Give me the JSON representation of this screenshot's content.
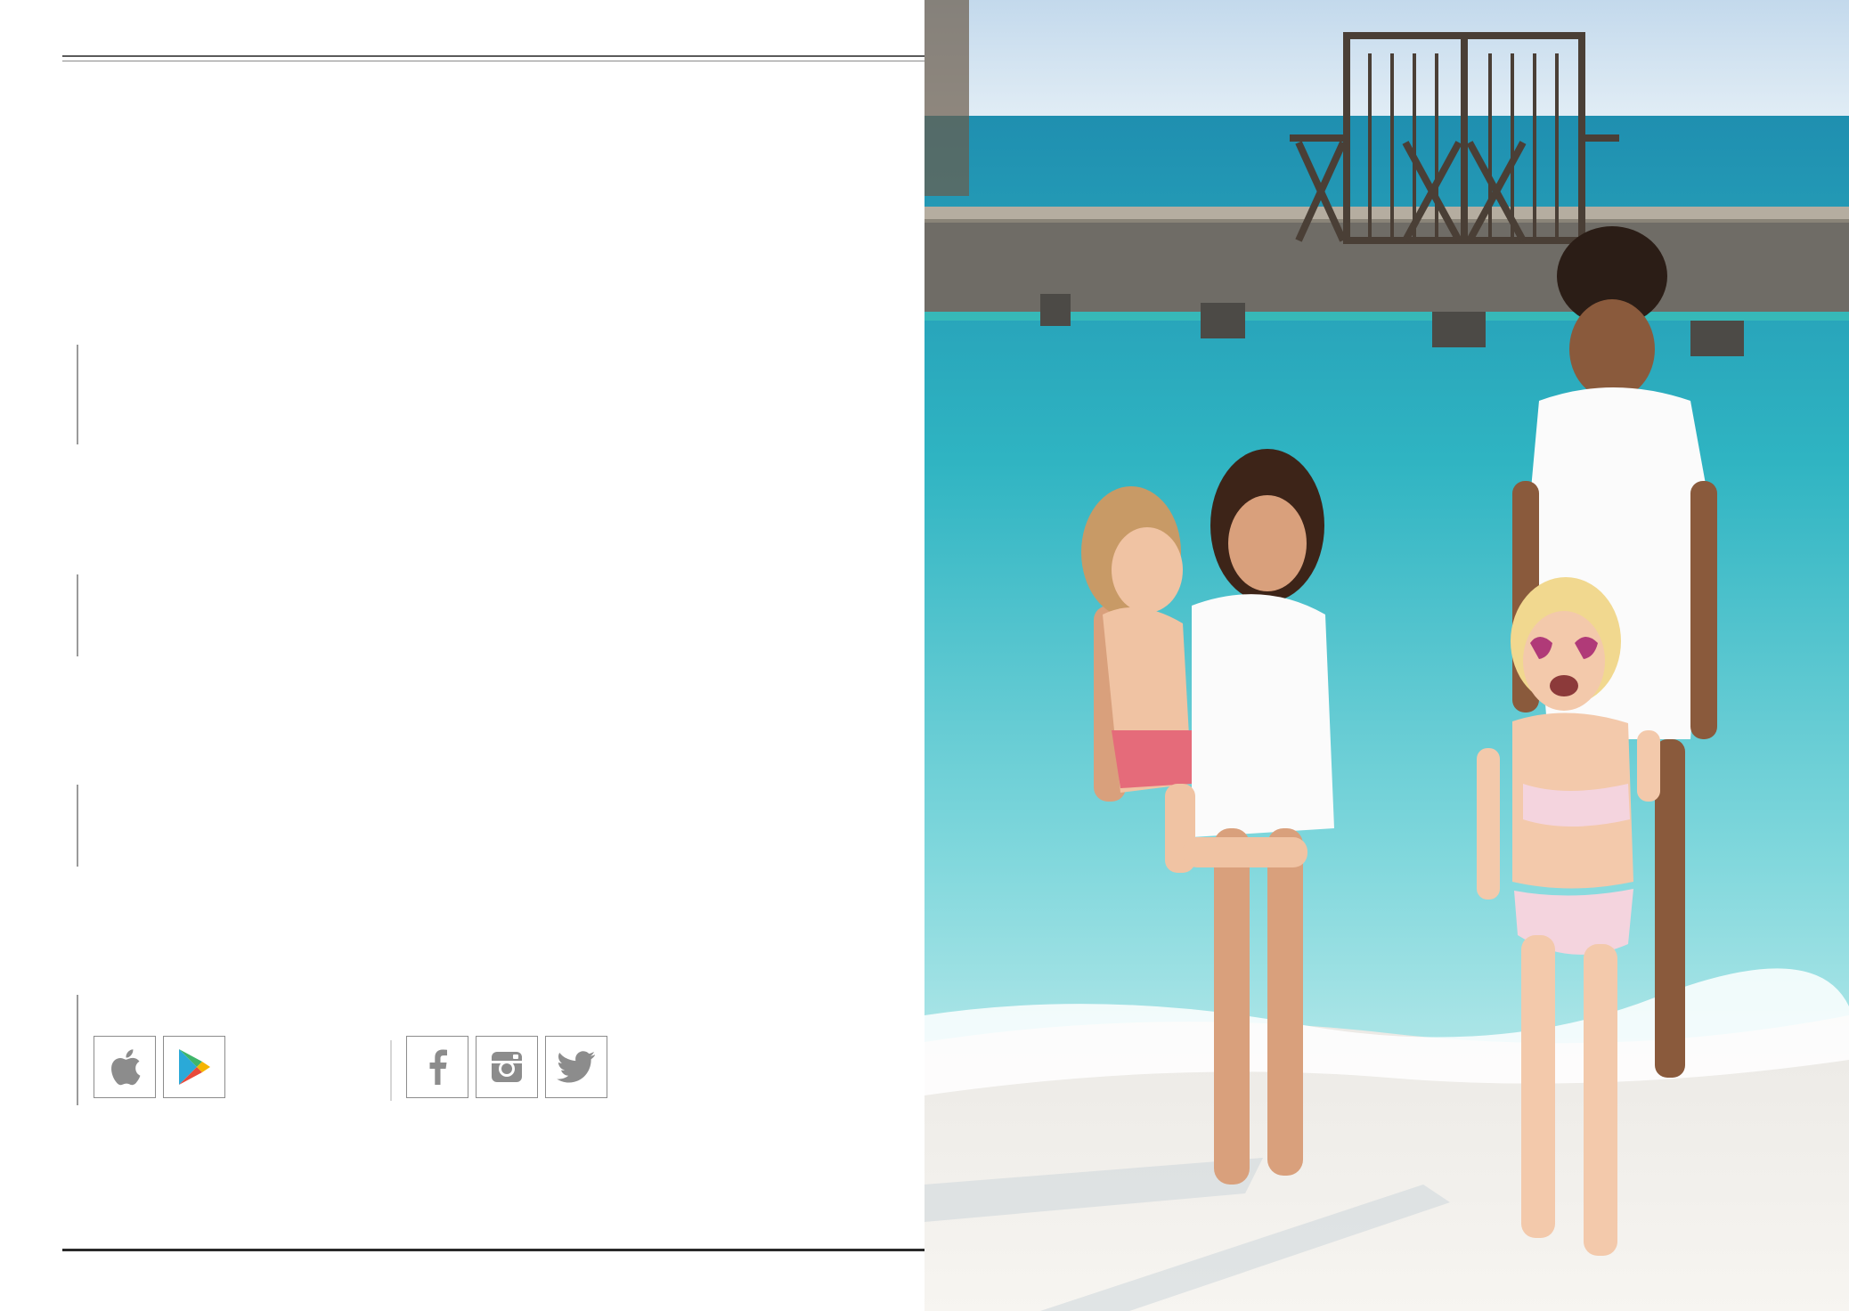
{
  "brochure": {
    "app_links": [
      {
        "icon": "apple-icon",
        "store": "app-store"
      },
      {
        "icon": "google-play-icon",
        "store": "google-play"
      }
    ],
    "social_links": [
      {
        "icon": "facebook-icon",
        "network": "facebook"
      },
      {
        "icon": "instagram-icon",
        "network": "instagram"
      },
      {
        "icon": "twitter-icon",
        "network": "twitter"
      }
    ],
    "colors": {
      "rule": "#2a2a2a",
      "icon_gray": "#8c8c8c",
      "sea": "#3bb8c9",
      "sky": "#cfe3f2",
      "sand": "#f4f1ec"
    }
  }
}
